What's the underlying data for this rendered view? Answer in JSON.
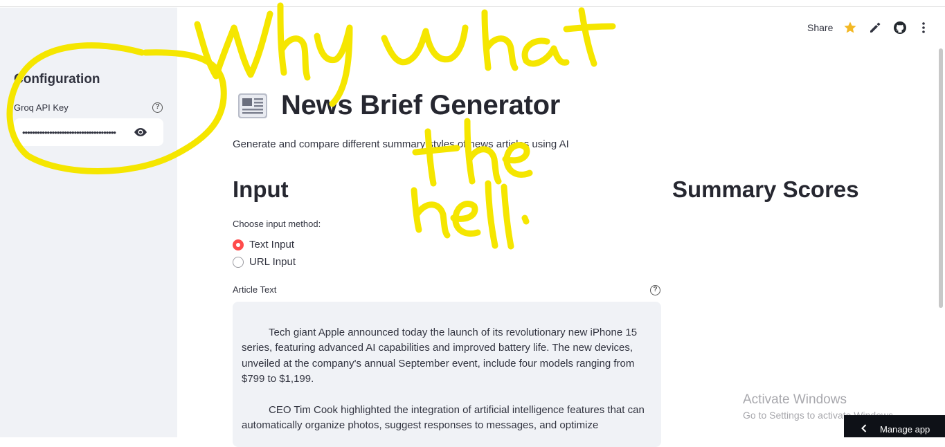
{
  "sidebar": {
    "title": "Configuration",
    "api_key_label": "Groq API Key",
    "api_key_value": "••••••••••••••••••••••••••••••••••••••",
    "help_icon_glyph": "?"
  },
  "toolbar": {
    "share_label": "Share",
    "icons": [
      "star-icon",
      "edit-icon",
      "github-icon",
      "more-vertical-icon"
    ],
    "star_color": "#f3b824"
  },
  "main": {
    "title": "News Brief Generator",
    "subtitle": "Generate and compare different summary styles of news articles using AI",
    "input_heading": "Input",
    "scores_heading": "Summary Scores",
    "input_method": {
      "label": "Choose input method:",
      "options": [
        "Text Input",
        "URL Input"
      ],
      "selected": "Text Input"
    },
    "article": {
      "label": "Article Text",
      "help_icon_glyph": "?",
      "paragraphs": [
        "Tech giant Apple announced today the launch of its revolutionary new iPhone 15 series, featuring advanced AI capabilities and improved battery life. The new devices, unveiled at the company's annual September event, include four models ranging from $799 to $1,199.",
        "CEO Tim Cook highlighted the integration of artificial intelligence features that can automatically organize photos, suggest responses to messages, and optimize"
      ]
    }
  },
  "watermark": {
    "title": "Activate Windows",
    "subtitle": "Go to Settings to activate Windows."
  },
  "manage_app": {
    "label": "Manage app"
  },
  "colors": {
    "accent": "#ff4b4b",
    "sidebar_bg": "#f0f2f6",
    "scribble": "#f5e600"
  }
}
